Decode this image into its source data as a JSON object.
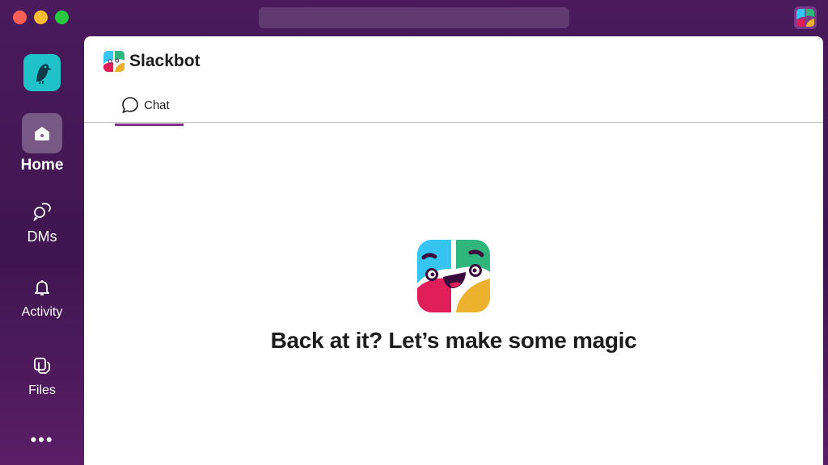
{
  "window": {
    "controls": [
      "close",
      "minimize",
      "maximize"
    ],
    "search_placeholder": ""
  },
  "sidebar": {
    "workspace_icon": "bird-logo-icon",
    "items": [
      {
        "label": "Home",
        "icon": "home-icon",
        "active": true
      },
      {
        "label": "DMs",
        "icon": "dms-icon",
        "active": false
      },
      {
        "label": "Activity",
        "icon": "bell-icon",
        "active": false
      },
      {
        "label": "Files",
        "icon": "files-icon",
        "active": false
      }
    ],
    "more_label": "•••"
  },
  "header": {
    "title": "Slackbot",
    "icon": "slackbot-logo-icon"
  },
  "tabs": [
    {
      "label": "Chat",
      "icon": "chat-bubble-icon",
      "active": true
    }
  ],
  "main": {
    "welcome_message": "Back at it? Let’s make some magic",
    "logo_icon": "slackbot-face-icon"
  },
  "colors": {
    "sidebar_bg": "#4a1a5c",
    "accent": "#7c3085",
    "workspace_teal": "#1ec2c8",
    "logo_blue": "#36c5f0",
    "logo_green": "#2eb67d",
    "logo_red": "#e01e5a",
    "logo_yellow": "#ecb22e"
  }
}
